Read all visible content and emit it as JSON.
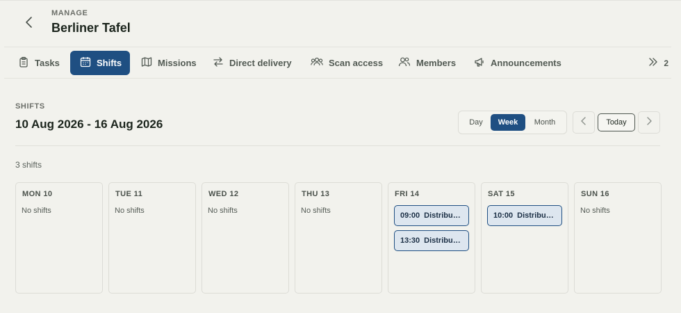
{
  "header": {
    "eyebrow": "MANAGE",
    "title": "Berliner Tafel",
    "back_icon": "chevron-left-icon"
  },
  "tabs": [
    {
      "label": "Tasks",
      "icon": "clipboard-icon",
      "active": false
    },
    {
      "label": "Shifts",
      "icon": "calendar-icon",
      "active": true
    },
    {
      "label": "Missions",
      "icon": "map-icon",
      "active": false
    },
    {
      "label": "Direct delivery",
      "icon": "swap-arrows-icon",
      "active": false
    },
    {
      "label": "Scan access",
      "icon": "people-group-icon",
      "active": false
    },
    {
      "label": "Members",
      "icon": "users-icon",
      "active": false
    },
    {
      "label": "Announcements",
      "icon": "megaphone-icon",
      "active": false
    }
  ],
  "tabs_more": {
    "count": "2",
    "icon": "double-chevron-right-icon"
  },
  "section": {
    "label": "SHIFTS",
    "range": "10 Aug 2026 - 16 Aug 2026",
    "count_text": "3 shifts"
  },
  "view_switch": {
    "day": "Day",
    "week": "Week",
    "month": "Month",
    "active": "Week"
  },
  "nav": {
    "today": "Today",
    "prev_icon": "chevron-left-icon",
    "next_icon": "chevron-right-icon"
  },
  "days": [
    {
      "label": "MON 10",
      "empty_text": "No shifts",
      "shifts": []
    },
    {
      "label": "TUE 11",
      "empty_text": "No shifts",
      "shifts": []
    },
    {
      "label": "WED 12",
      "empty_text": "No shifts",
      "shifts": []
    },
    {
      "label": "THU 13",
      "empty_text": "No shifts",
      "shifts": []
    },
    {
      "label": "FRI 14",
      "empty_text": "",
      "shifts": [
        {
          "time": "09:00",
          "name": "Distribut…"
        },
        {
          "time": "13:30",
          "name": "Distribut…"
        }
      ]
    },
    {
      "label": "SAT 15",
      "empty_text": "",
      "shifts": [
        {
          "time": "10:00",
          "name": "Distribut…"
        }
      ]
    },
    {
      "label": "SUN 16",
      "empty_text": "No shifts",
      "shifts": []
    }
  ],
  "colors": {
    "accent": "#1f4f82",
    "background": "#f2f2ed",
    "chip_bg": "#dde6ef"
  }
}
